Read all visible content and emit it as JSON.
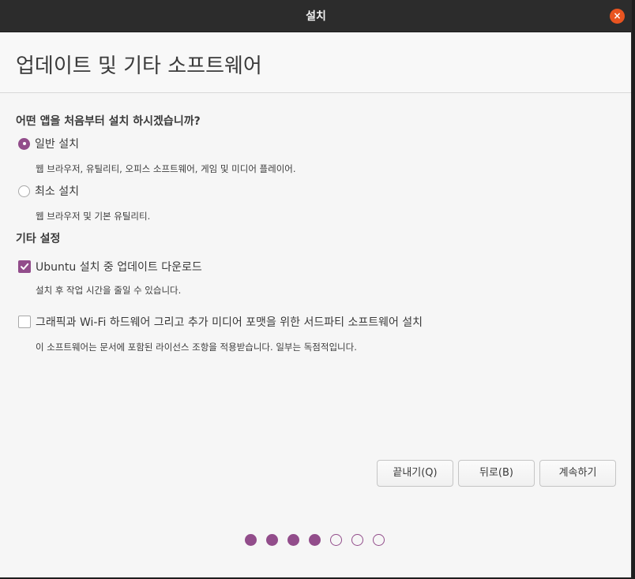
{
  "window": {
    "title": "설치",
    "close_glyph": "×"
  },
  "page": {
    "title": "업데이트 및 기타 소프트웨어"
  },
  "apps_section": {
    "question": "어떤 앱을 처음부터 설치 하시겠습니까?",
    "options": [
      {
        "label": "일반 설치",
        "description": "웹 브라우저, 유틸리티, 오피스  소프트웨어, 게임 및 미디어 플레이어.",
        "selected": true
      },
      {
        "label": "최소 설치",
        "description": "웹 브라우저 및 기본 유틸리티.",
        "selected": false
      }
    ]
  },
  "other_section": {
    "heading": "기타 설정",
    "options": [
      {
        "label": "Ubuntu 설치 중 업데이트 다운로드",
        "description": "설치 후 작업 시간을 줄일 수 있습니다.",
        "checked": true
      },
      {
        "label": "그래픽과 Wi-Fi 하드웨어 그리고 추가 미디어 포맷을 위한 서드파티 소프트웨어 설치",
        "description": "이 소프트웨어는 문서에 포함된 라이선스 조항을 적용받습니다. 일부는 독점적입니다.",
        "checked": false
      }
    ]
  },
  "buttons": {
    "quit": "끝내기(Q)",
    "back": "뒤로(B)",
    "continue": "계속하기"
  },
  "progress": {
    "total_steps": 7,
    "completed_steps": 4
  },
  "colors": {
    "accent": "#924d8b",
    "close": "#e95420",
    "titlebar": "#2c2c2c",
    "background": "#f6f6f6"
  },
  "icons": {
    "close": "close-icon",
    "check": "checkmark-icon",
    "radio": "radio-dot-icon"
  }
}
